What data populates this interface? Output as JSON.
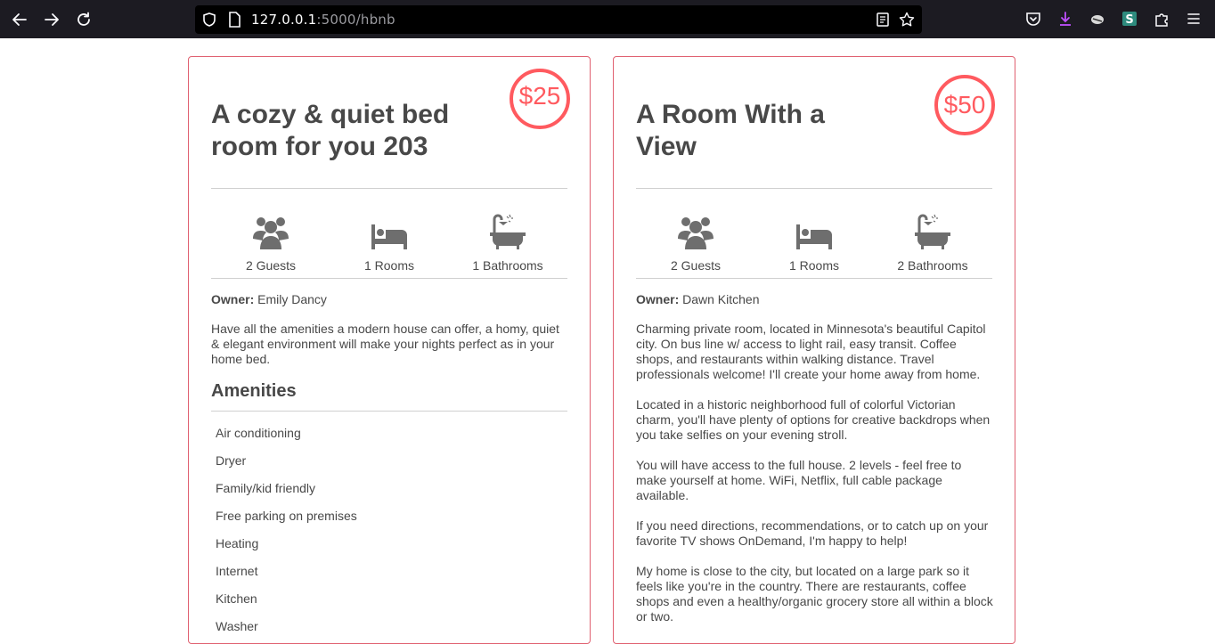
{
  "browser": {
    "url_host": "127.0.0.1",
    "url_path": ":5000/hbnb"
  },
  "places": [
    {
      "title": "A cozy & quiet bed room for you 203",
      "price": "$25",
      "guests": "2 Guests",
      "rooms": "1 Rooms",
      "bathrooms": "1 Bathrooms",
      "owner_label": "Owner:",
      "owner_name": "Emily Dancy",
      "description": [
        "Have all the amenities a modern house can offer, a homy, quiet & elegant environment will make your nights perfect as in your home bed."
      ],
      "amenities_title": "Amenities",
      "amenities": [
        "Air conditioning",
        "Dryer",
        "Family/kid friendly",
        "Free parking on premises",
        "Heating",
        "Internet",
        "Kitchen",
        "Washer"
      ]
    },
    {
      "title": "A Room With a View",
      "price": "$50",
      "guests": "2 Guests",
      "rooms": "1 Rooms",
      "bathrooms": "2 Bathrooms",
      "owner_label": "Owner:",
      "owner_name": "Dawn Kitchen",
      "description": [
        "Charming private room, located in Minnesota's beautiful Capitol city. On bus line w/ access to light rail, easy transit. Coffee shops, and restaurants within walking distance. Travel professionals welcome! I'll create your home away from home.",
        "Located in a historic neighborhood full of colorful Victorian charm, you'll have plenty of options for creative backdrops when you take selfies on your evening stroll.",
        "You will have access to the full house. 2 levels - feel free to make yourself at home. WiFi, Netflix, full cable package available.",
        "If you need directions, recommendations, or to catch up on your favorite TV shows OnDemand, I'm happy to help!",
        "My home is close to the city, but located on a large park so it feels like you're in the country. There are restaurants, coffee shops and even a healthy/organic grocery store all within a block or two."
      ]
    }
  ],
  "colors": {
    "accent": "#ff5a5f",
    "border": "#e06070",
    "text": "#484848",
    "chrome": "#1c1b22"
  }
}
